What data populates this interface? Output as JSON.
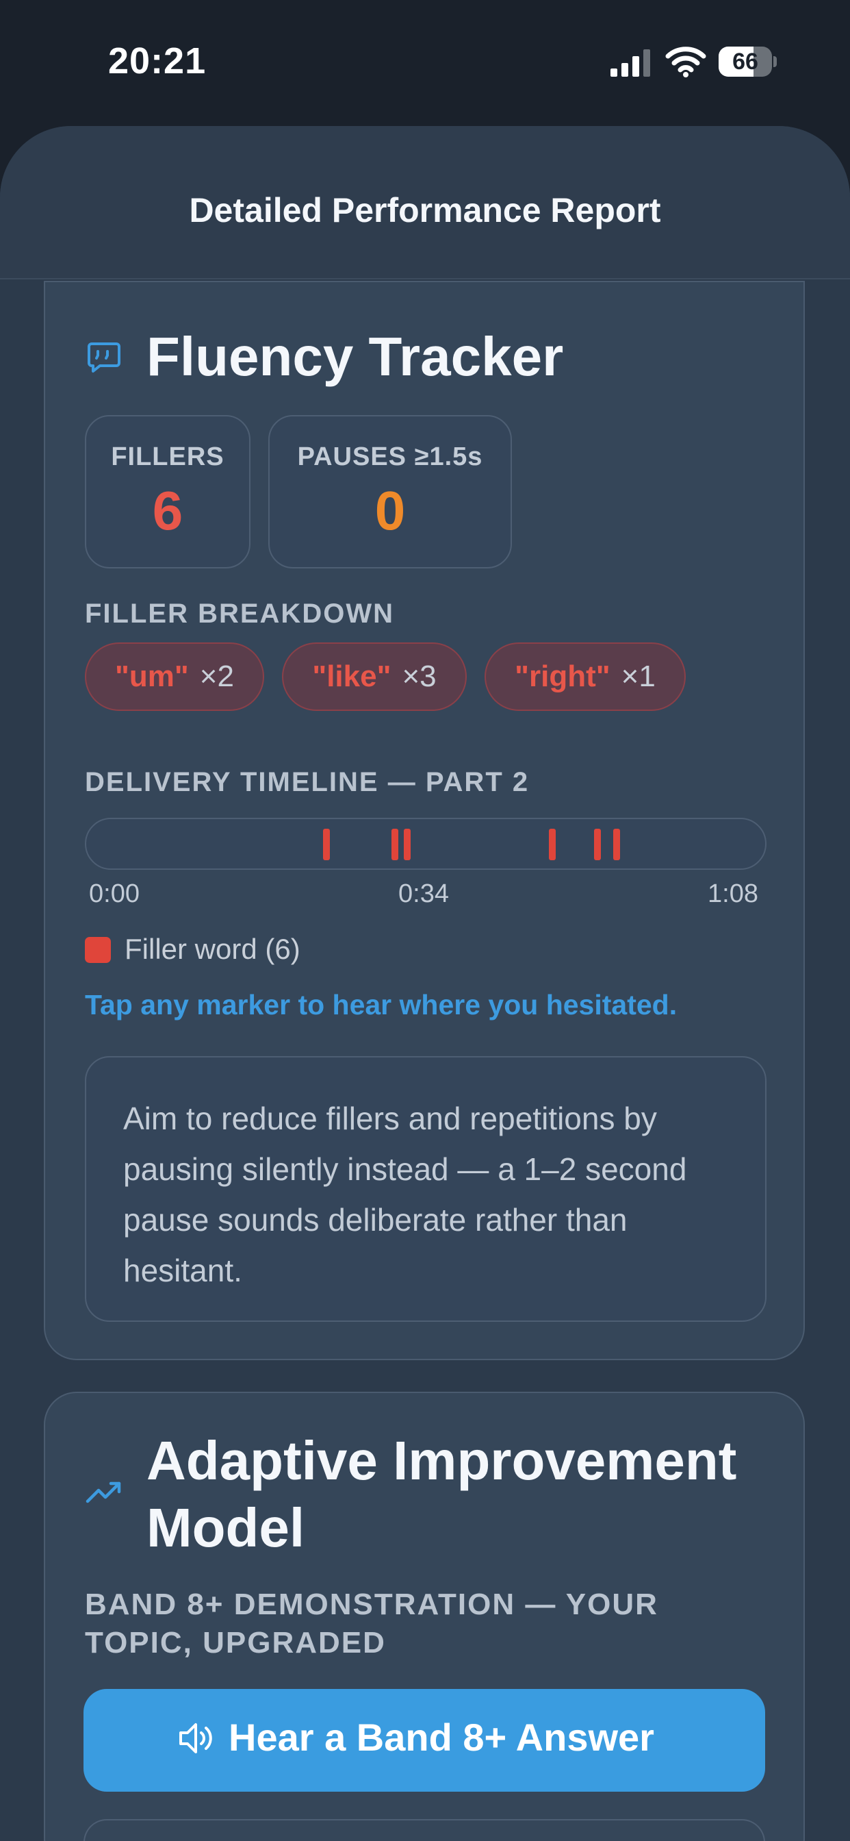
{
  "status_bar": {
    "time": "20:21",
    "battery": "66",
    "battery_level": 0.66
  },
  "header": {
    "title": "Detailed Performance Report"
  },
  "fluency": {
    "title": "Fluency Tracker",
    "icon": "chat-bubble-quote-icon",
    "stats": [
      {
        "label": "FILLERS",
        "value": "6",
        "color": "#e8574a"
      },
      {
        "label": "PAUSES ≥1.5s",
        "value": "0",
        "color": "#ef8a2a"
      }
    ],
    "breakdown_label": "FILLER BREAKDOWN",
    "fillers": [
      {
        "word": "\"um\"",
        "count": "×2"
      },
      {
        "word": "\"like\"",
        "count": "×3"
      },
      {
        "word": "\"right\"",
        "count": "×1"
      }
    ],
    "timeline_label": "DELIVERY TIMELINE — PART 2",
    "timeline_ticks": [
      "0:00",
      "0:34",
      "1:08"
    ],
    "legend": "Filler word (6)",
    "tap_hint": "Tap any marker to hear where you hesitated.",
    "tip": "Aim to reduce fillers and repetitions by pausing silently instead — a 1–2 second pause sounds deliberate rather than hesitant."
  },
  "adaptive": {
    "title_line1": "Adaptive Improvement",
    "title_line2": "Model",
    "icon": "trending-up-icon",
    "subtitle_line1": "BAND 8+ DEMONSTRATION — YOUR",
    "subtitle_line2": "TOPIC, UPGRADED",
    "cta_label": "Hear a Band 8+ Answer",
    "cta_icon": "speaker-icon"
  },
  "colors": {
    "accent": "#3a9ce0",
    "filler": "#e0453a",
    "pause": "#ef8a2a"
  }
}
